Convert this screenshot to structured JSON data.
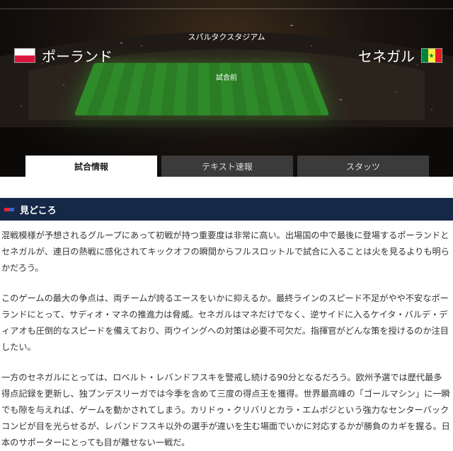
{
  "match": {
    "stadium": "スパルタクスタジアム",
    "status": "試合前",
    "home_team": "ポーランド",
    "away_team": "セネガル",
    "home_flag": "flag-poland-icon",
    "away_flag": "flag-senegal-icon"
  },
  "tabs": [
    {
      "label": "試合情報"
    },
    {
      "label": "テキスト速報"
    },
    {
      "label": "スタッツ"
    }
  ],
  "section": {
    "title": "見どころ"
  },
  "article": {
    "paragraphs": [
      "混戦模様が予想されるグループにあって初戦が持つ重要度は非常に高い。出場国の中で最後に登場するポーランドとセネガルが、連日の熱戦に感化されてキックオフの瞬間からフルスロットルで試合に入ることは火を見るよりも明らかだろう。",
      "このゲームの最大の争点は、両チームが誇るエースをいかに抑えるか。最終ラインのスピード不足がやや不安なポーランドにとって、サディオ・マネの推進力は脅威。セネガルはマネだけでなく、逆サイドに入るケイタ・バルデ・ディアオも圧倒的なスピードを備えており、両ウイングへの対策は必要不可欠だ。指揮官がどんな策を授けるのか注目したい。",
      "一方のセネガルにとっては、ロベルト・レバンドフスキを警戒し続ける90分となるだろう。欧州予選では歴代最多得点記録を更新し、独ブンデスリーガでは今季を含めて三度の得点王を獲得。世界最高峰の「ゴールマシン」に一瞬でも隙を与えれば、ゲームを動かされてしまう。カリドゥ・クリバリとカラ・エムボジという強力なセンターバックコンビが目を光らせるが、レバンドフスキ以外の選手が違いを生む場面でいかに対応するかが勝負のカギを握る。日本のサポーターにとっても目が離せない一戦だ。"
    ]
  },
  "colors": {
    "section_bg": "#152848",
    "tab_inactive": "#3b3b3b",
    "senegal_green": "#00853f",
    "senegal_yellow": "#fdef42",
    "senegal_red": "#e31b23",
    "poland_red": "#dc143c"
  }
}
